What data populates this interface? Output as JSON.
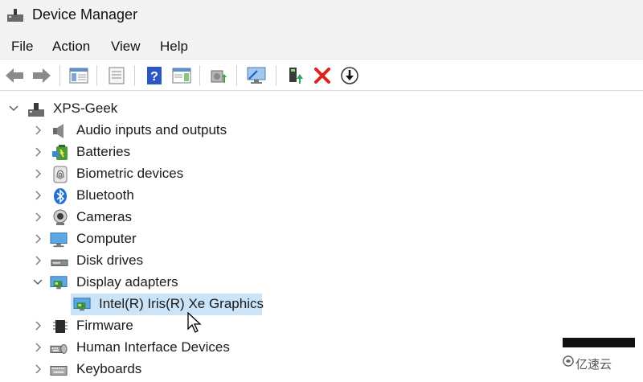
{
  "window": {
    "title": "Device Manager"
  },
  "menu": [
    "File",
    "Action",
    "View",
    "Help"
  ],
  "toolbar": {
    "buttons": [
      "back-arrow-icon",
      "forward-arrow-icon",
      "show-hide-console-tree-icon",
      "properties-icon",
      "help-icon",
      "action-pane-icon",
      "update-driver-icon",
      "scan-hardware-icon",
      "enable-device-icon",
      "uninstall-device-icon",
      "download-icon"
    ],
    "uninstall_color": "#e0201b",
    "help_color": "#2b57c4"
  },
  "tree": {
    "root": "XPS-Geek",
    "categories": [
      {
        "label": "Audio inputs and outputs",
        "icon": "speaker-icon",
        "expanded": false
      },
      {
        "label": "Batteries",
        "icon": "battery-icon",
        "expanded": false
      },
      {
        "label": "Biometric devices",
        "icon": "fingerprint-icon",
        "expanded": false
      },
      {
        "label": "Bluetooth",
        "icon": "bluetooth-icon",
        "expanded": false
      },
      {
        "label": "Cameras",
        "icon": "camera-icon",
        "expanded": false
      },
      {
        "label": "Computer",
        "icon": "monitor-icon",
        "expanded": false
      },
      {
        "label": "Disk drives",
        "icon": "disk-drive-icon",
        "expanded": false
      },
      {
        "label": "Display adapters",
        "icon": "display-adapter-icon",
        "expanded": true
      },
      {
        "label": "Firmware",
        "icon": "chip-icon",
        "expanded": false
      },
      {
        "label": "Human Interface Devices",
        "icon": "hid-icon",
        "expanded": false
      },
      {
        "label": "Keyboards",
        "icon": "keyboard-icon",
        "expanded": false
      }
    ],
    "display_child": "Intel(R) Iris(R) Xe Graphics",
    "selection_color": "#cce4f7"
  },
  "watermark": "亿速云"
}
